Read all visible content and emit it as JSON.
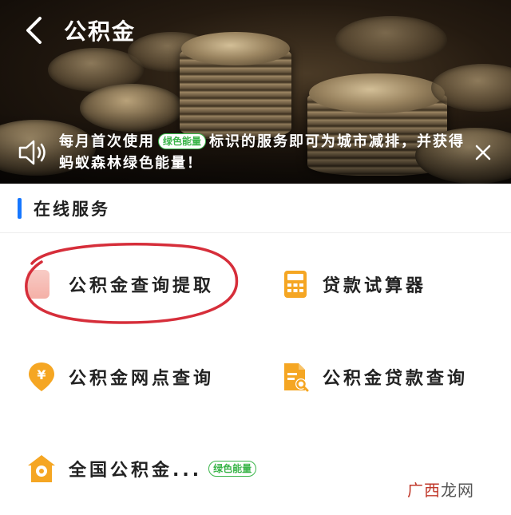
{
  "header": {
    "title": "公积金",
    "back_icon": "chevron-left-icon"
  },
  "notice": {
    "text_before": "每月首次使用",
    "badge": "绿色能量",
    "text_after": "标识的服务即可为城市减排，并获得蚂蚁森林绿色能量！",
    "icon": "speaker-icon",
    "close_icon": "close-icon"
  },
  "section": {
    "title": "在线服务",
    "accent": "#1677ff"
  },
  "services": [
    {
      "label": "公积金查询提取",
      "icon": "app-icon",
      "highlighted": true
    },
    {
      "label": "贷款试算器",
      "icon": "calculator-icon"
    },
    {
      "label": "公积金网点查询",
      "icon": "location-yen-icon"
    },
    {
      "label": "公积金贷款查询",
      "icon": "document-search-icon"
    },
    {
      "label": "全国公积金...",
      "icon": "house-location-icon",
      "badge": "绿色能量"
    }
  ],
  "colors": {
    "icon_orange": "#f5a623",
    "badge_green": "#3bb54a",
    "highlight_red": "#d62e3a"
  },
  "watermark": {
    "red_part": "广西",
    "dark_part": "龙网"
  }
}
